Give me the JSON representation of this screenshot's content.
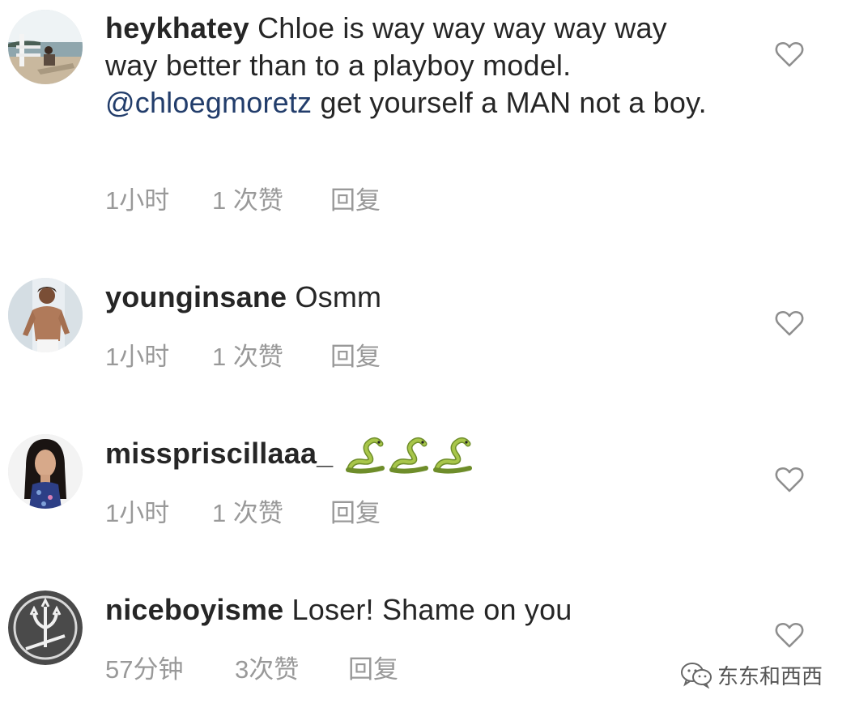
{
  "comments": [
    {
      "username": "heykhatey",
      "text_before": "Chloe is way way way way way way better than to a playboy model.",
      "mention": "@chloegmoretz",
      "text_after": " get yourself a MAN not a boy.",
      "time": "1小时",
      "likes": "1 次赞",
      "reply": "回复",
      "avatar_icon": "lakeside-photo-avatar"
    },
    {
      "username": "younginsane",
      "text": "Osmm",
      "time": "1小时",
      "likes": "1 次赞",
      "reply": "回复",
      "avatar_icon": "shirtless-man-avatar"
    },
    {
      "username": "misspriscillaaa_",
      "text": "",
      "emoji": [
        "snake-emoji",
        "snake-emoji",
        "snake-emoji"
      ],
      "time": "1小时",
      "likes": "1 次赞",
      "reply": "回复",
      "avatar_icon": "woman-portrait-avatar"
    },
    {
      "username": "niceboyisme",
      "text": "Loser! Shame on you",
      "time": "57分钟",
      "likes": "3次赞",
      "reply": "回复",
      "avatar_icon": "maserati-trident-avatar"
    }
  ],
  "watermark": {
    "text": "东东和西西",
    "icon": "wechat-icon"
  },
  "colors": {
    "text": "#262626",
    "meta": "#999999",
    "mention": "#223d6b",
    "heart_stroke": "#8e8e8e"
  }
}
